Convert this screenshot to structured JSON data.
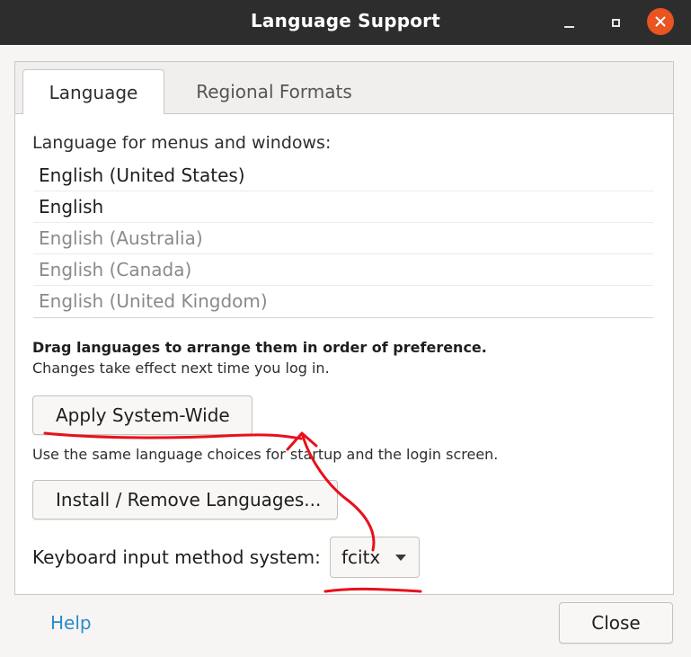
{
  "window": {
    "title": "Language Support"
  },
  "tabs": [
    {
      "label": "Language",
      "active": true
    },
    {
      "label": "Regional Formats",
      "active": false
    }
  ],
  "language_tab": {
    "section_label": "Language for menus and windows:",
    "languages": [
      {
        "label": "English (United States)",
        "dimmed": false
      },
      {
        "label": "English",
        "dimmed": false
      },
      {
        "label": "English (Australia)",
        "dimmed": true
      },
      {
        "label": "English (Canada)",
        "dimmed": true
      },
      {
        "label": "English (United Kingdom)",
        "dimmed": true
      }
    ],
    "drag_note": "Drag languages to arrange them in order of preference.",
    "change_note": "Changes take effect next time you log in.",
    "apply_button": "Apply System-Wide",
    "use_note": "Use the same language choices for startup and the login screen.",
    "install_button": "Install / Remove Languages...",
    "keyboard_label": "Keyboard input method system:",
    "keyboard_value": "fcitx"
  },
  "footer": {
    "help_label": "Help",
    "close_label": "Close"
  },
  "colors": {
    "titlebar": "#2d2d2d",
    "close_button": "#e95420",
    "link": "#2a8cc8",
    "annotation": "#e8101b"
  },
  "icons": [
    "minimize-icon",
    "maximize-icon",
    "close-icon",
    "chevron-down-icon"
  ]
}
